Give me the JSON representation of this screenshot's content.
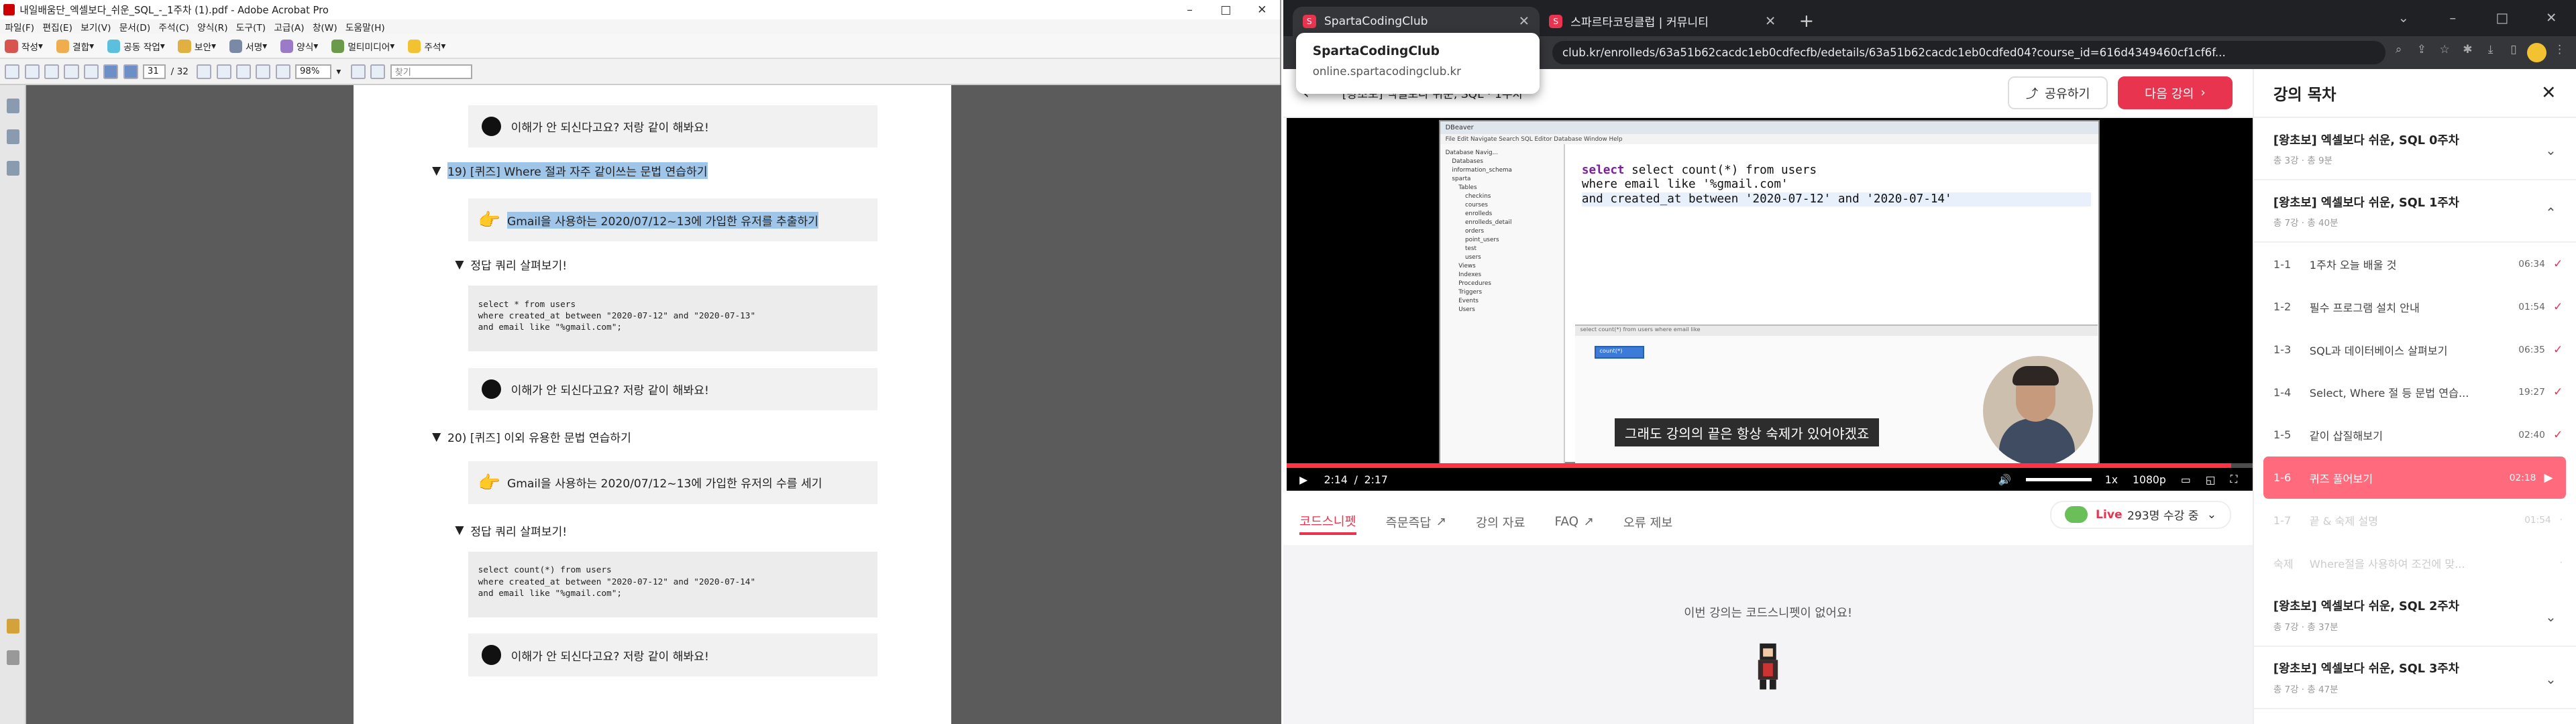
{
  "acrobat": {
    "title": "내일배움단_엑셀보다_쉬운_SQL_-_1주차 (1).pdf - Adobe Acrobat Pro",
    "menu": [
      "파일(F)",
      "편집(E)",
      "보기(V)",
      "문서(D)",
      "주석(C)",
      "양식(R)",
      "도구(T)",
      "고급(A)",
      "창(W)",
      "도움말(H)"
    ],
    "toolbar1": [
      "작성",
      "결합",
      "공동 작업",
      "보안",
      "서명",
      "양식",
      "멀티미디어",
      "주석"
    ],
    "page_current": "31",
    "page_total": "/ 32",
    "zoom": "98%",
    "find_placeholder": "찾기",
    "content": {
      "top_callout": "이해가 안 되신다고요? 저랑 같이 해봐요!",
      "heading19": "19) [퀴즈] Where 절과 자주 같이쓰는 문법 연습하기",
      "quiz19": "Gmail을 사용하는 2020/07/12~13에 가입한 유저를 추출하기",
      "toggle19": "정답 쿼리 살펴보기!",
      "code19": "select * from users\nwhere created_at between \"2020-07-12\" and \"2020-07-13\"\nand email like \"%gmail.com\";",
      "callout19": "이해가 안 되신다고요? 저랑 같이 해봐요!",
      "heading20": "20) [퀴즈] 이외 유용한 문법 연습하기",
      "quiz20": "Gmail을 사용하는 2020/07/12~13에 가입한 유저의 수를 세기",
      "toggle20": "정답 쿼리 살펴보기!",
      "code20": "select count(*) from users\nwhere created_at between \"2020-07-12\" and \"2020-07-14\"\nand email like \"%gmail.com\";",
      "callout20": "이해가 안 되신다고요? 저랑 같이 해봐요!"
    }
  },
  "chrome": {
    "tabs": [
      {
        "label": "SpartaCodingClub",
        "active": true
      },
      {
        "label": "스파르타코딩클럽 | 커뮤니티",
        "active": false
      }
    ],
    "url": "club.kr/enrolleds/63a51b62cacdc1eb0cdfecfb/edetails/63a51b62cacdc1eb0cdfed04?course_id=616d4349460cf1cf6f...",
    "tooltip_title": "SpartaCodingClub",
    "tooltip_url": "online.spartacodingclub.kr"
  },
  "player": {
    "breadcrumb": "[왕초보] 엑셀보다 쉬운, SQL · 1주차",
    "share": "공유하기",
    "next": "다음 강의",
    "sql_line1": "select count(*) from users",
    "sql_line2": "where email like '%gmail.com'",
    "sql_line3": "and created_at between '2020-07-12' and '2020-07-14'",
    "subtitle": "그래도 강의의 끝은 항상 숙제가 있어야겠죠",
    "time_current": "2:14",
    "time_sep": "/",
    "time_total": "2:17",
    "progress": 0.978,
    "speed": "1x",
    "quality": "1080p",
    "tabs": [
      "코드스니펫",
      "즉문즉답",
      "강의 자료",
      "FAQ",
      "오류 제보"
    ],
    "live_label": "Live",
    "live_count": "293명 수강 중",
    "empty_msg": "이번 강의는 코드스니펫이 없어요!",
    "db_tree": [
      "Database Navig...",
      "Databases",
      "information_schema",
      "sparta",
      "Tables",
      "checkins",
      "courses",
      "enrolleds",
      "enrolleds_detail",
      "orders",
      "point_users",
      "test",
      "users",
      "Views",
      "Indexes",
      "Procedures",
      "Triggers",
      "Events",
      "Users"
    ],
    "result_header": "count(*)",
    "result_filter": "select count(*) from users where email like"
  },
  "toc": {
    "title": "강의 목차",
    "weeks": [
      {
        "title": "[왕초보] 엑셀보다 쉬운, SQL 0주차",
        "meta": "총 3강 · 총 9분",
        "open": false
      },
      {
        "title": "[왕초보] 엑셀보다 쉬운, SQL 1주차",
        "meta": "총 7강 · 총 40분",
        "open": true
      },
      {
        "title": "[왕초보] 엑셀보다 쉬운, SQL 2주차",
        "meta": "총 7강 · 총 37분",
        "open": false
      },
      {
        "title": "[왕초보] 엑셀보다 쉬운, SQL 3주차",
        "meta": "총 7강 · 총 47분",
        "open": false
      }
    ],
    "lessons": [
      {
        "num": "1-1",
        "title": "1주차 오늘 배울 것",
        "dur": "06:34",
        "state": "done"
      },
      {
        "num": "1-2",
        "title": "필수 프로그램 설치 안내",
        "dur": "01:54",
        "state": "done"
      },
      {
        "num": "1-3",
        "title": "SQL과 데이터베이스 살펴보기",
        "dur": "06:35",
        "state": "done"
      },
      {
        "num": "1-4",
        "title": "Select, Where 절 등 문법 연습...",
        "dur": "19:27",
        "state": "done"
      },
      {
        "num": "1-5",
        "title": "같이 삽질해보기",
        "dur": "02:40",
        "state": "done"
      },
      {
        "num": "1-6",
        "title": "퀴즈 풀어보기",
        "dur": "02:18",
        "state": "current"
      },
      {
        "num": "1-7",
        "title": "끝 & 숙제 설명",
        "dur": "01:54",
        "state": "todo"
      },
      {
        "num": "숙제",
        "title": "Where절을 사용하여 조건에 맞...",
        "dur": "",
        "state": "todo"
      }
    ]
  },
  "colors": {
    "accent": "#e8344e",
    "highlight": "#9fc5e8",
    "dark": "#202124"
  }
}
